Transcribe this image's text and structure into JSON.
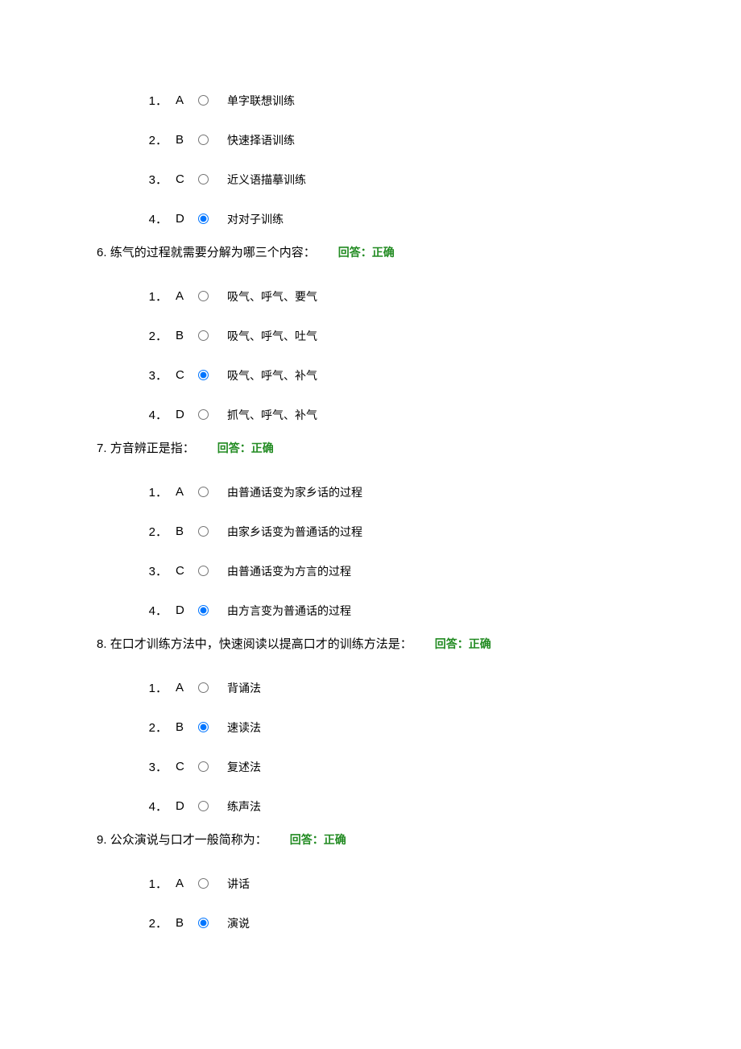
{
  "feedback_label": "回答：正确",
  "questions": [
    {
      "num": "",
      "text": "",
      "feedback": false,
      "selected": "D",
      "options": [
        {
          "idx": "1．",
          "letter": "A",
          "text": "单字联想训练"
        },
        {
          "idx": "2．",
          "letter": "B",
          "text": "快速择语训练"
        },
        {
          "idx": "3．",
          "letter": "C",
          "text": "近义语描摹训练"
        },
        {
          "idx": "4．",
          "letter": "D",
          "text": "对对子训练"
        }
      ]
    },
    {
      "num": "6. ",
      "text": "练气的过程就需要分解为哪三个内容：",
      "feedback": true,
      "selected": "C",
      "options": [
        {
          "idx": "1．",
          "letter": "A",
          "text": "吸气、呼气、要气"
        },
        {
          "idx": "2．",
          "letter": "B",
          "text": "吸气、呼气、吐气"
        },
        {
          "idx": "3．",
          "letter": "C",
          "text": "吸气、呼气、补气"
        },
        {
          "idx": "4．",
          "letter": "D",
          "text": "抓气、呼气、补气"
        }
      ]
    },
    {
      "num": "7. ",
      "text": "方音辨正是指：",
      "feedback": true,
      "selected": "D",
      "options": [
        {
          "idx": "1．",
          "letter": "A",
          "text": "由普通话变为家乡话的过程"
        },
        {
          "idx": "2．",
          "letter": "B",
          "text": "由家乡话变为普通话的过程"
        },
        {
          "idx": "3．",
          "letter": "C",
          "text": "由普通话变为方言的过程"
        },
        {
          "idx": "4．",
          "letter": "D",
          "text": "由方言变为普通话的过程"
        }
      ]
    },
    {
      "num": "8. ",
      "text": "在口才训练方法中，快速阅读以提高口才的训练方法是：",
      "feedback": true,
      "selected": "B",
      "options": [
        {
          "idx": "1．",
          "letter": "A",
          "text": "背诵法"
        },
        {
          "idx": "2．",
          "letter": "B",
          "text": "速读法"
        },
        {
          "idx": "3．",
          "letter": "C",
          "text": "复述法"
        },
        {
          "idx": "4．",
          "letter": "D",
          "text": "练声法"
        }
      ]
    },
    {
      "num": "9. ",
      "text": "公众演说与口才一般简称为：",
      "feedback": true,
      "selected": "B",
      "options": [
        {
          "idx": "1．",
          "letter": "A",
          "text": "讲话"
        },
        {
          "idx": "2．",
          "letter": "B",
          "text": "演说"
        }
      ]
    }
  ]
}
